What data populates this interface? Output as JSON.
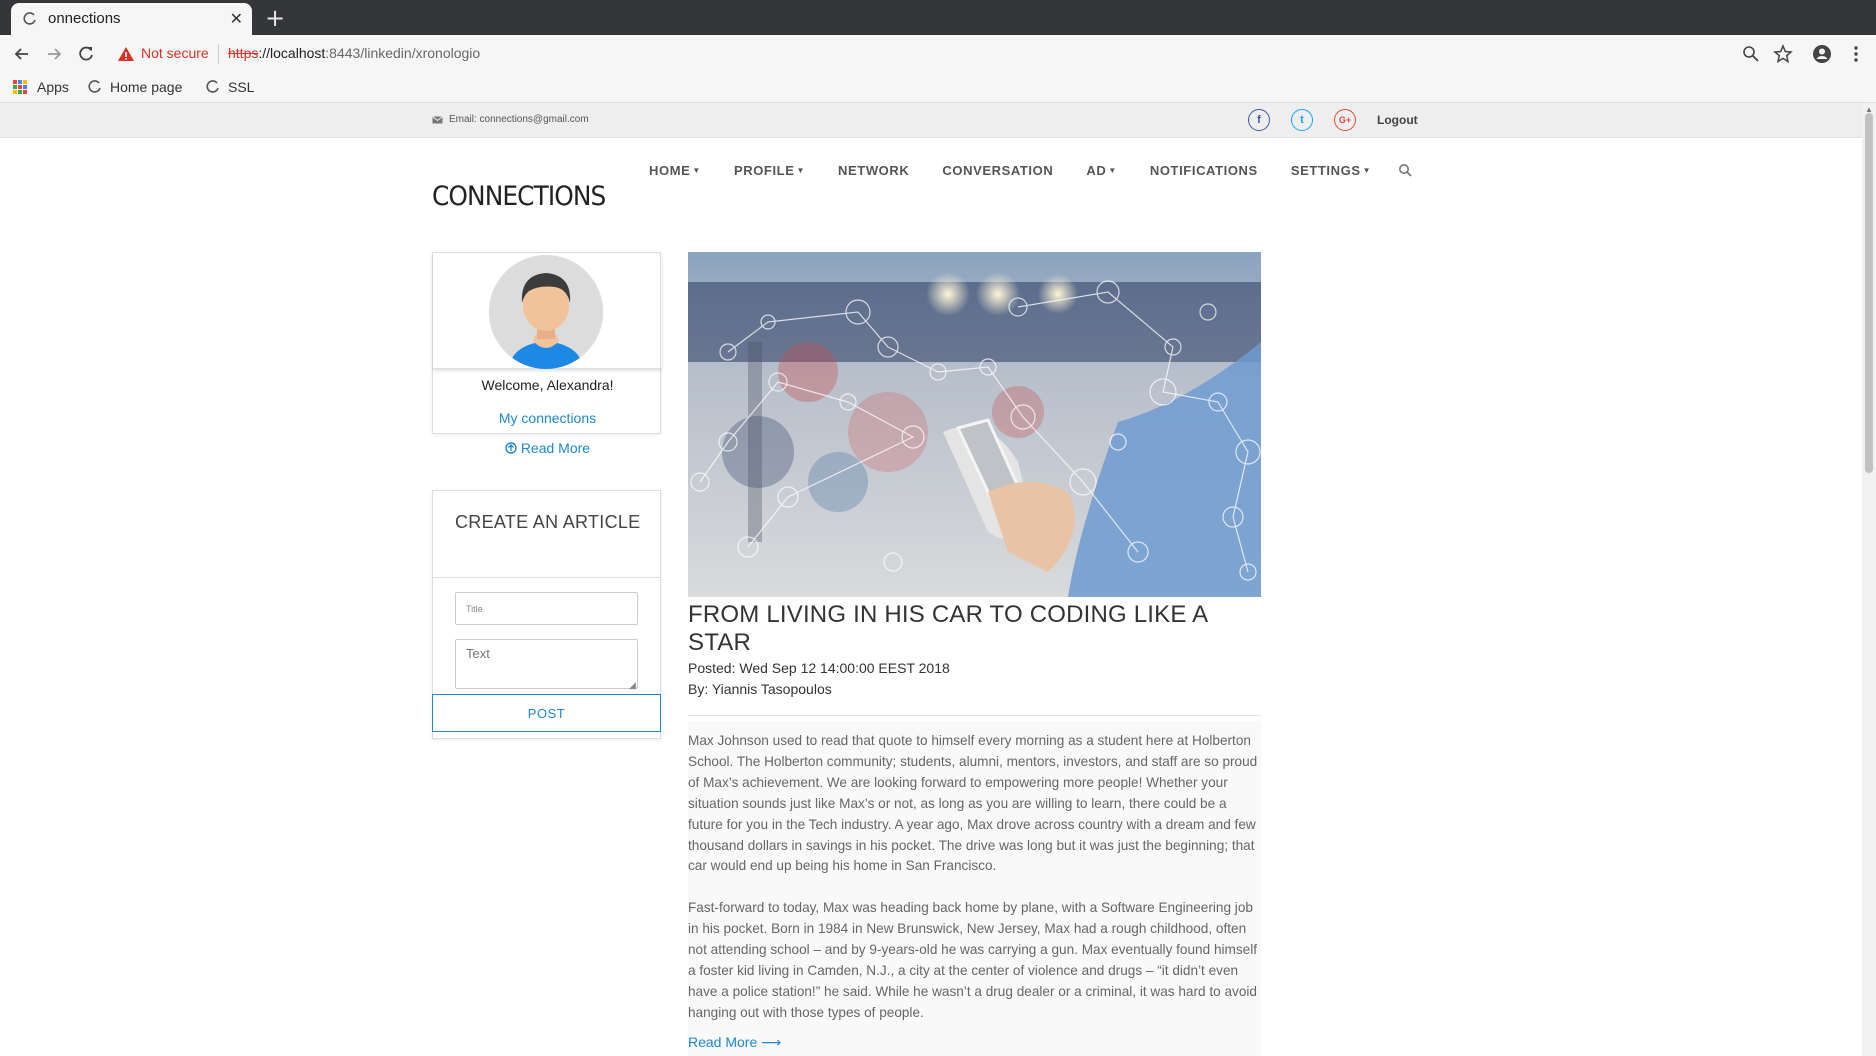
{
  "browser": {
    "tab_title": "onnections",
    "security_label": "Not secure",
    "url_scheme": "https",
    "url_host": "://localhost",
    "url_rest": ":8443/linkedin/xronologio",
    "bookmarks": {
      "apps": "Apps",
      "home": "Home page",
      "ssl": "SSL"
    }
  },
  "topbar": {
    "email": "Email: connections@gmail.com",
    "social": {
      "facebook": "f",
      "twitter": "t",
      "google": "G+"
    },
    "logout": "Logout"
  },
  "site": {
    "logo": "CONNECTIONS"
  },
  "nav": {
    "home": "HOME",
    "profile": "PROFILE",
    "network": "NETWORK",
    "conversation": "CONVERSATION",
    "ad": "AD",
    "notifications": "NOTIFICATIONS",
    "settings": "SETTINGS"
  },
  "profile": {
    "welcome": "Welcome, Alexandra!",
    "my_connections": "My connections",
    "read_more": "Read More"
  },
  "create_article": {
    "heading": "CREATE AN ARTICLE",
    "title_placeholder": "Title",
    "text_placeholder": "Text",
    "post_label": "POST"
  },
  "article": {
    "title": "FROM LIVING IN HIS CAR TO CODING LIKE A STAR",
    "posted": "Posted: Wed Sep 12 14:00:00 EEST 2018",
    "by": "By: Yiannis Tasopoulos",
    "paragraph1": "Max Johnson used to read that quote to himself every morning as a student here at Holberton School. The Holberton community; students, alumni, mentors, investors, and staff are so proud of Max’s achievement. We are looking forward to empowering more people! Whether your situation sounds just like Max’s or not, as long as you are willing to learn, there could be a future for you in the Tech industry. A year ago, Max drove across country with a dream and few thousand dollars in savings in his pocket. The drive was long but it was just the beginning; that car would end up being his home in San Francisco.",
    "paragraph2": "Fast-forward to today, Max was heading back home by plane, with a Software Engineering job in his pocket. Born in 1984 in New Brunswick, New Jersey, Max had a rough childhood, often not attending school – and by 9-years-old he was carrying a gun. Max eventually found himself a foster kid living in Camden, N.J., a city at the center of violence and drugs – “it didn’t even have a police station!” he said. While he wasn’t a drug dealer or a criminal, it was hard to avoid hanging out with those types of people.",
    "read_more": "Read More ⟶"
  },
  "colors": {
    "link": "#1e88c8",
    "warning": "#d93025",
    "facebook": "#3b5998",
    "twitter": "#1da1f2",
    "google": "#dd4b39"
  }
}
